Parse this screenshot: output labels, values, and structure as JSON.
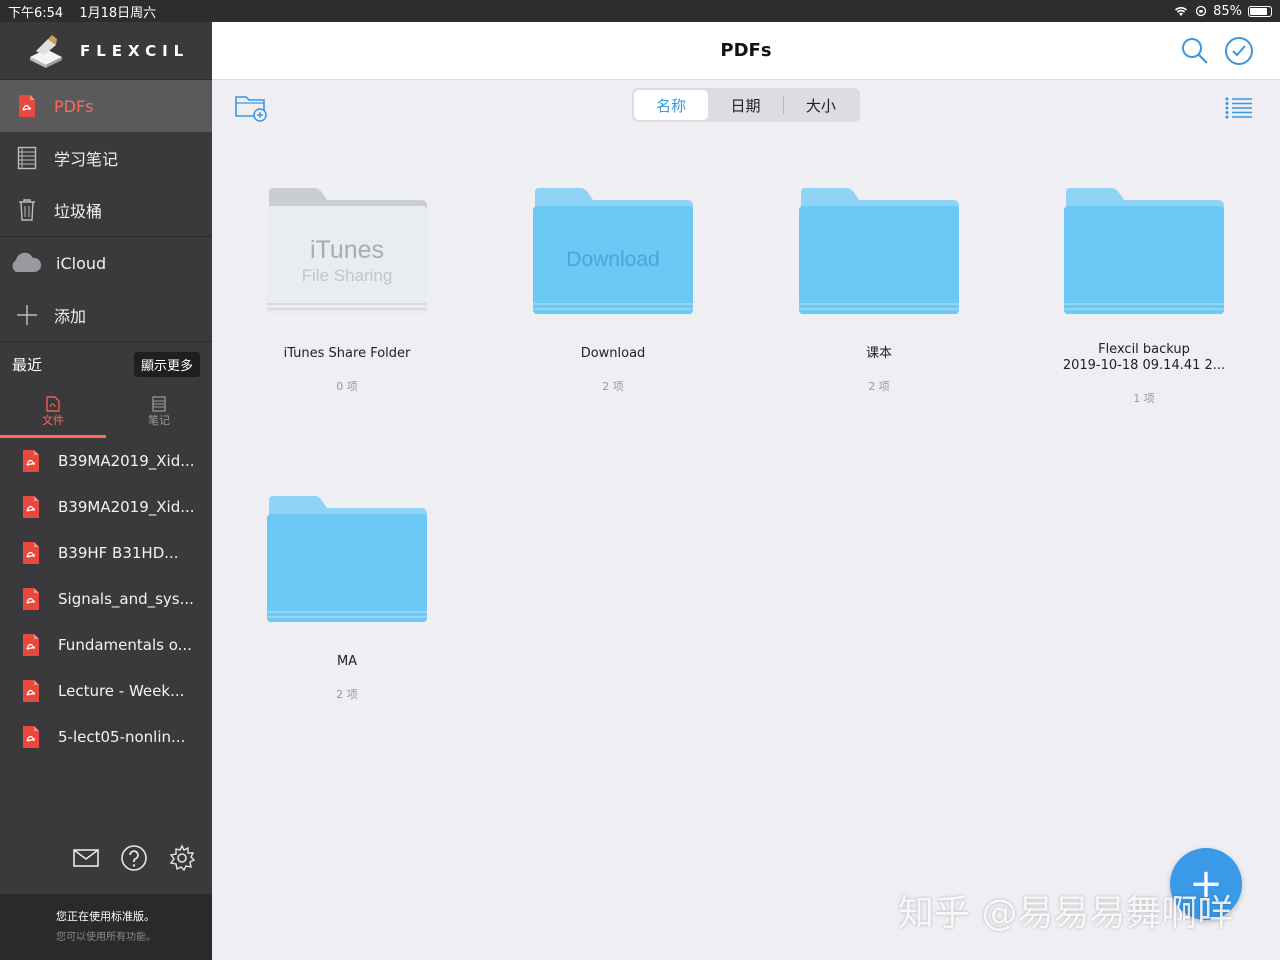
{
  "status": {
    "time": "下午6:54",
    "date": "1月18日周六",
    "battery": "85%"
  },
  "brand": {
    "name": "FLEXCIL"
  },
  "nav": [
    {
      "label": "PDFs",
      "icon": "pdf-icon",
      "active": true
    },
    {
      "label": "学习笔记",
      "icon": "notebook-icon"
    },
    {
      "label": "垃圾桶",
      "icon": "trash-icon"
    },
    {
      "label": "iCloud",
      "icon": "cloud-icon"
    },
    {
      "label": "添加",
      "icon": "plus-icon"
    }
  ],
  "recent": {
    "title": "最近",
    "more_label": "顯示更多",
    "tabs": [
      {
        "label": "文件",
        "active": true
      },
      {
        "label": "笔记"
      }
    ],
    "files": [
      "B39MA2019_Xid...",
      "B39MA2019_Xid...",
      "B39HF  B31HD...",
      "Signals_and_sys...",
      "Fundamentals o...",
      "Lecture - Week...",
      "5-lect05-nonlin..."
    ]
  },
  "promo": {
    "title": "您正在使用标准版。",
    "subtitle": "您可以使用所有功能。"
  },
  "main": {
    "title": "PDFs",
    "sort_options": [
      "名称",
      "日期",
      "大小"
    ],
    "folders": [
      {
        "name": "iTunes Share Folder",
        "count": "0 项",
        "art_line1": "iTunes",
        "art_line2": "File Sharing"
      },
      {
        "name": "Download",
        "count": "2 项",
        "art_line1": "Download"
      },
      {
        "name": "课本",
        "count": "2 项"
      },
      {
        "name_line1": "Flexcil backup",
        "name_line2": "2019-10-18 09.14.41 2...",
        "count": "1 项"
      },
      {
        "name": "MA",
        "count": "2 项"
      }
    ]
  },
  "fab_label": "+",
  "watermark": "知乎 @易易易舞啊咩",
  "colors": {
    "accent": "#3a97e0",
    "sidebar": "#3a3a3c",
    "active_red": "#ff6a5c",
    "folder_blue": "#6cc8f4"
  }
}
